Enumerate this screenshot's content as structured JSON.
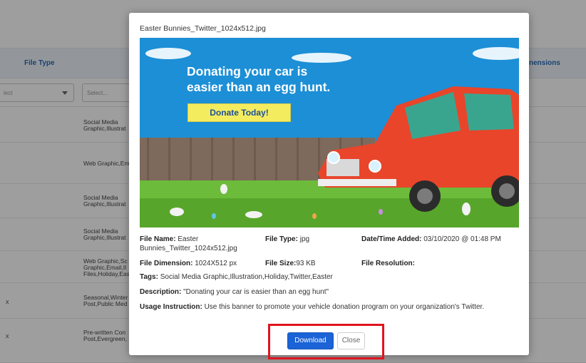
{
  "table": {
    "headers": {
      "file_type": "File Type",
      "dimensions_partial": "nensions"
    },
    "filters": {
      "type_select": "lect",
      "tags_select": "Select..."
    },
    "rows": [
      {
        "tags": "Social Media\nGraphic,Illustrat",
        "dim": ""
      },
      {
        "tags": "Web Graphic,Em",
        "dim": ""
      },
      {
        "tags": "Social Media\nGraphic,Illustrat",
        "dim": ""
      },
      {
        "tags": "Social Media\nGraphic,Illustrat",
        "dim": ""
      },
      {
        "tags": "Web Graphic,Sc\nGraphic,Email,Il\nFiles,Holiday,Eas",
        "dim": ""
      },
      {
        "tags": "Seasonal,Winter\nPost,Public Med",
        "dim": "x"
      },
      {
        "tags": "Pre-written Con\nPost,Evergreen,",
        "dim": "x"
      }
    ]
  },
  "modal": {
    "title": "Easter Bunnies_Twitter_1024x512.jpg",
    "banner": {
      "headline": "Donating your car is\neasier than an egg hunt.",
      "cta": "Donate Today!"
    },
    "info": {
      "file_name_label": "File Name:",
      "file_name_value": "Easter\nBunnies_Twitter_1024x512.jpg",
      "file_type_label": "File Type:",
      "file_type_value": "jpg",
      "date_label": "Date/Time Added:",
      "date_value": "03/10/2020 @ 01:48 PM",
      "dimension_label": "File Dimension:",
      "dimension_value": "1024X512 px",
      "size_label": "File Size:",
      "size_value": "93 KB",
      "resolution_label": "File Resolution:",
      "resolution_value": "",
      "tags_label": "Tags:",
      "tags_value": "Social Media Graphic,Illustration,Holiday,Twitter,Easter",
      "description_label": "Description:",
      "description_value": "\"Donating your car is easier than an egg hunt\"",
      "usage_label": "Usage Instruction:",
      "usage_value": "Use this banner to promote your vehicle donation program on your organization's Twitter."
    },
    "buttons": {
      "download": "Download",
      "close": "Close"
    },
    "colors": {
      "primary": "#1b63d6",
      "highlight": "#e0141e",
      "banner_sky": "#1c8fd6",
      "cta_yellow": "#f4ec5f",
      "car_red": "#e8452b"
    }
  }
}
